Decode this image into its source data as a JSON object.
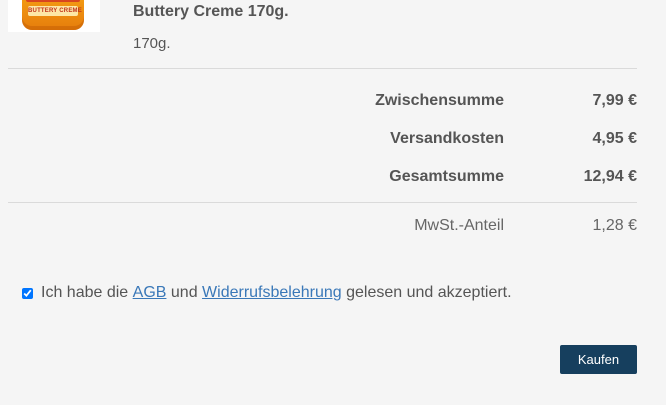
{
  "product": {
    "name": "Buttery Creme 170g.",
    "variant": "170g.",
    "image_label": "BUTTERY CREME"
  },
  "totals": {
    "subtotal_label": "Zwischensumme",
    "subtotal_value": "7,99 €",
    "shipping_label": "Versandkosten",
    "shipping_value": "4,95 €",
    "total_label": "Gesamtsumme",
    "total_value": "12,94 €",
    "tax_label": "MwSt.-Anteil",
    "tax_value": "1,28 €"
  },
  "agreement": {
    "checked": true,
    "text_before": "Ich habe die",
    "agb_link": "AGB",
    "text_middle": "und",
    "revocation_link": "Widerrufsbelehrung",
    "text_after": "gelesen und akzeptiert."
  },
  "actions": {
    "buy_label": "Kaufen"
  },
  "colors": {
    "button_bg": "#163f5e",
    "link": "#3a78b8",
    "text": "#555555",
    "background": "#f5f5f5"
  }
}
